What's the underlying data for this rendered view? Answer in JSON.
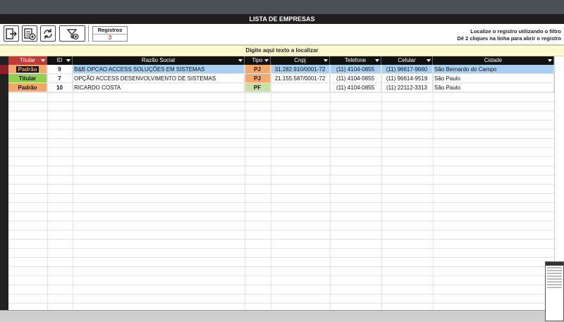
{
  "window": {
    "title": "LISTA DE  EMPRESAS"
  },
  "toolbar": {
    "buttons": [
      {
        "name": "exit-button",
        "icon": "exit-icon"
      },
      {
        "name": "new-record-button",
        "icon": "new-record-icon"
      },
      {
        "name": "refresh-button",
        "icon": "refresh-icon"
      },
      {
        "name": "clear-filter-button",
        "icon": "filter-clear-icon"
      }
    ],
    "registros_label": "Registros",
    "registros_value": "3",
    "hint_line1": "Localize o registro utilizando o filtro",
    "hint_line2": "Dê 2 cliques na linha para abrir o registro"
  },
  "search": {
    "placeholder": "Digite aqui texto a localizar"
  },
  "table": {
    "columns": [
      "Titular",
      "ID",
      "Razão Social",
      "Tipo",
      "Cnpj",
      "Telefone",
      "Celular",
      "Cidade"
    ],
    "rows": [
      {
        "titular": "Padrão",
        "id": "9",
        "razao": "B&B OPCAO ACCESS SOLUÇÕES EM SISTEMAS",
        "tipo": "PJ",
        "cnpj": "31.282.910/0001-72",
        "telefone": "(11) 4104-0855",
        "celular": "(11) 96617-9660",
        "cidade": "São Bernardo do Campo"
      },
      {
        "titular": "Titular",
        "id": "7",
        "razao": "OPÇÃO ACCESS DESENVOLVIMENTO DE SISTEMAS",
        "tipo": "PJ",
        "cnpj": "21.155.587/0001-72",
        "telefone": "(11) 4104-0855",
        "celular": "(11) 96614-9519",
        "cidade": "São Paulo"
      },
      {
        "titular": "Padrão",
        "id": "10",
        "razao": "RICARDO COSTA",
        "tipo": "PF",
        "cnpj": "",
        "telefone": "(11) 4104-0855",
        "celular": "(11) 22112-3313",
        "cidade": "São Paulo"
      }
    ]
  },
  "colors": {
    "selected_row": "#a9d0f0",
    "titular_padrao": "#f4a96b",
    "titular_titular": "#8fd14f",
    "tipo_pj": "#f4a96b",
    "tipo_pf": "#c8e0a8",
    "titular_header": "#c03a3a"
  }
}
